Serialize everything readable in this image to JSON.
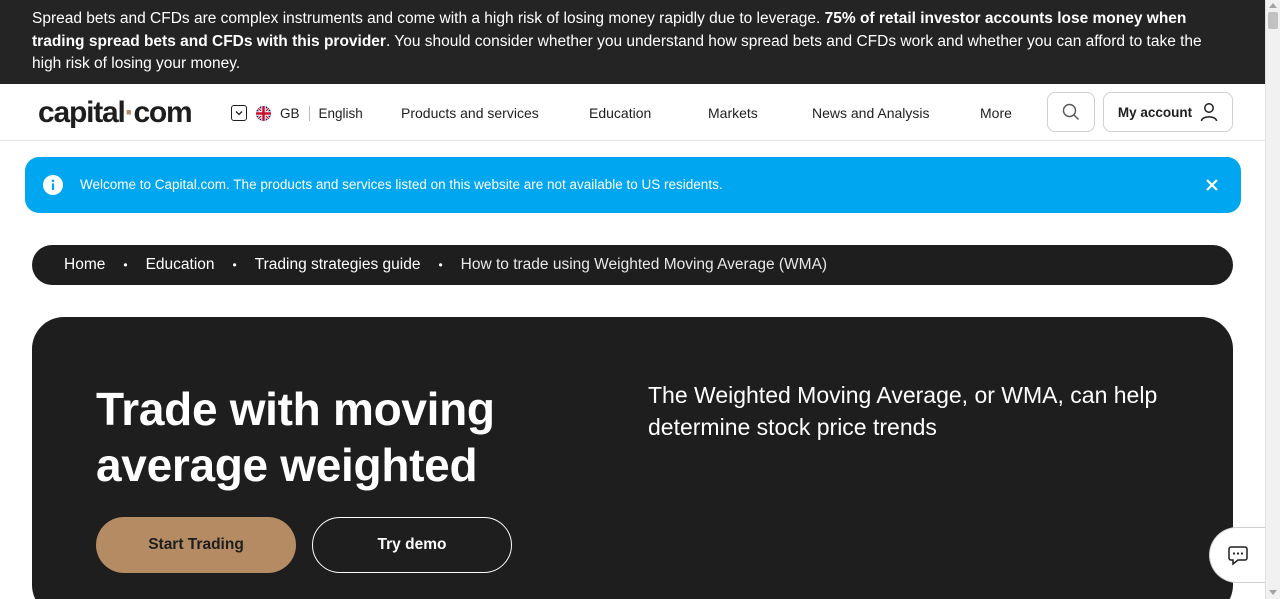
{
  "risk_warning": {
    "text_start": "Spread bets and CFDs are complex instruments and come with a high risk of losing money rapidly due to leverage. ",
    "text_bold": "75% of retail investor accounts lose money when trading spread bets and CFDs with this provider",
    "text_end": ". You should consider whether you understand how spread bets and CFDs work and whether you can afford to take the high risk of losing your money."
  },
  "header": {
    "logo_part1": "capital",
    "logo_dot": "·",
    "logo_part2": "com",
    "region_code": "GB",
    "language": "English",
    "nav": [
      "Products and services",
      "Education",
      "Markets",
      "News and Analysis",
      "More"
    ],
    "account_label": "My account"
  },
  "notice": {
    "message": "Welcome to Capital.com. The products and services listed on this website are not available to US residents."
  },
  "breadcrumb": {
    "items": [
      "Home",
      "Education",
      "Trading strategies guide"
    ],
    "current": "How to trade using Weighted Moving Average (WMA)",
    "separator": "•"
  },
  "hero": {
    "title": "Trade with moving average weighted",
    "subtitle": "The Weighted Moving Average, or WMA, can help determine stock price trends",
    "primary_cta": "Start Trading",
    "secondary_cta": "Try demo"
  },
  "colors": {
    "dark": "#1e1e1e",
    "accent": "#b58b63",
    "info_blue": "#00a6f0"
  }
}
